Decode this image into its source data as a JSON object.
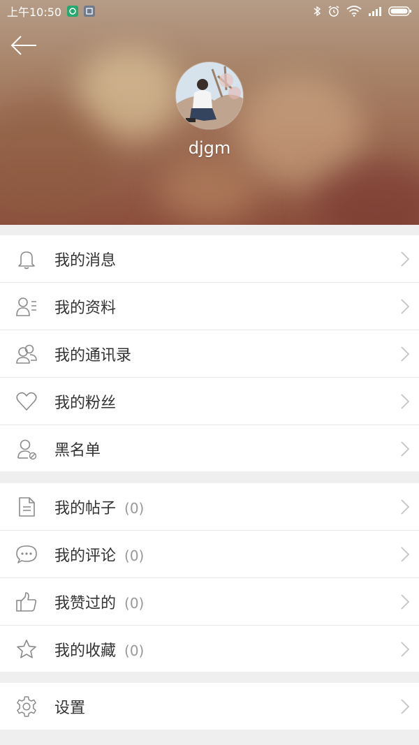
{
  "status_bar": {
    "time": "上午10:50",
    "battery": "100"
  },
  "profile": {
    "username": "djgm"
  },
  "menu_group_1": [
    {
      "label": "我的消息",
      "icon": "bell-icon"
    },
    {
      "label": "我的资料",
      "icon": "profile-list-icon"
    },
    {
      "label": "我的通讯录",
      "icon": "contacts-icon"
    },
    {
      "label": "我的粉丝",
      "icon": "heart-icon"
    },
    {
      "label": "黑名单",
      "icon": "user-block-icon"
    }
  ],
  "menu_group_2": [
    {
      "label": "我的帖子",
      "count": "(0)",
      "icon": "document-icon"
    },
    {
      "label": "我的评论",
      "count": "(0)",
      "icon": "comment-icon"
    },
    {
      "label": "我赞过的",
      "count": "(0)",
      "icon": "thumbs-up-icon"
    },
    {
      "label": "我的收藏",
      "count": "(0)",
      "icon": "star-icon"
    }
  ],
  "menu_group_3": [
    {
      "label": "设置",
      "icon": "gear-icon"
    }
  ],
  "colors": {
    "text": "#333333",
    "count": "#999999",
    "icon_stroke": "#8a8a8a",
    "chevron": "#c4c4c4",
    "background": "#efefef"
  }
}
